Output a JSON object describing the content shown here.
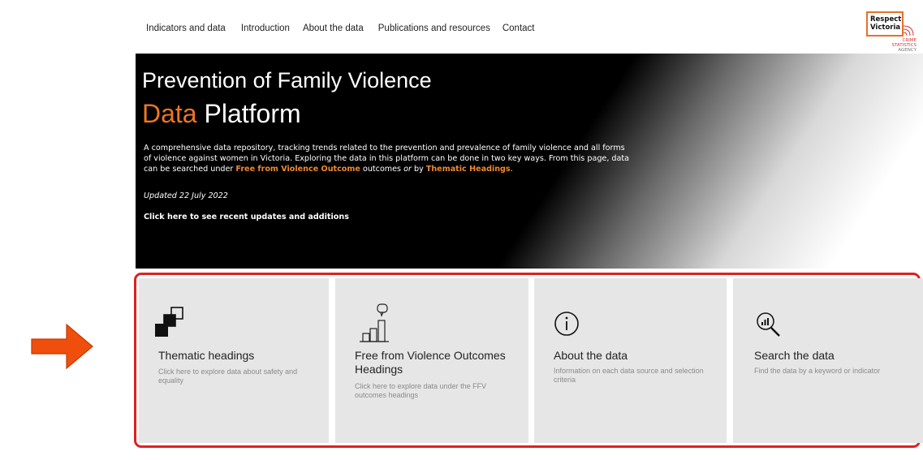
{
  "nav": {
    "items": [
      "Indicators and data",
      "Introduction",
      "About the data",
      "Publications and resources",
      "Contact"
    ]
  },
  "logo": {
    "line1": "Respect",
    "line2": "Victoria",
    "sub1": "CRIME",
    "sub2": "STATISTICS",
    "sub3": "AGENCY"
  },
  "hero": {
    "title_line1": "Prevention of Family Violence",
    "title_word_accent": "Data",
    "title_word_rest": " Platform",
    "desc_part1": "A comprehensive data repository, tracking trends related to the prevention and prevalence of family violence and all forms of violence against women in Victoria.  Exploring the data in this platform can be done in two key ways. From this page, data can be searched under ",
    "desc_link1": "Free from Violence Outcome",
    "desc_part2": " outcomes ",
    "desc_or": "or",
    "desc_part3": " by ",
    "desc_link2": "Thematic Headings",
    "desc_end": ".",
    "updated": "Updated 22 July 2022",
    "updates_link": "Click here to see recent updates and additions"
  },
  "cards": [
    {
      "icon": "stacked-squares-icon",
      "title": "Thematic headings",
      "desc": "Click here to explore data about safety and equality"
    },
    {
      "icon": "bar-chart-comment-icon",
      "title": "Free from Violence Outcomes Headings",
      "desc": "Click here to explore data under the FFV outcomes headings"
    },
    {
      "icon": "info-icon",
      "title": "About the data",
      "desc": "Information on each data source and selection criteria"
    },
    {
      "icon": "search-chart-icon",
      "title": "Search the data",
      "desc": "Find the data by a keyword or indicator"
    }
  ],
  "colors": {
    "accent": "#ee7623",
    "highlight_frame": "#e02020",
    "card_bg": "#e6e6e6",
    "arrow": "#f04e0c"
  }
}
